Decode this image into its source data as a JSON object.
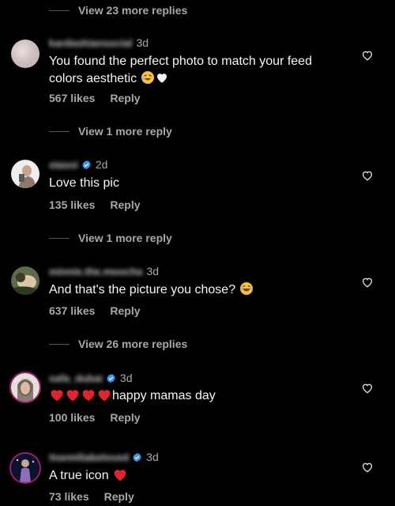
{
  "threads": [
    {
      "view_more": "View 23 more replies"
    },
    {
      "username": "kardashiansocial",
      "verified": false,
      "time": "3d",
      "text": "You found the perfect photo to match your feed colors aesthetic",
      "emoji": [
        "rolling-laughing-emoji",
        "white-heart-emoji"
      ],
      "likes": "567 likes",
      "reply": "Reply",
      "view_more": "View 1 more reply"
    },
    {
      "username": "stassi",
      "verified": true,
      "time": "2d",
      "text": "Love this pic",
      "likes": "135 likes",
      "reply": "Reply",
      "view_more": "View 1 more reply"
    },
    {
      "username": "minnie.the.moocha",
      "verified": false,
      "time": "3d",
      "text": "And that's the picture you chose?",
      "emoji": [
        "laughing-emoji"
      ],
      "likes": "637 likes",
      "reply": "Reply",
      "view_more": "View 26 more replies"
    },
    {
      "username": "safa_dubai",
      "verified": true,
      "time": "3d",
      "text": "happy mamas day",
      "emoji": [
        "red-heart-emoji",
        "red-heart-emoji",
        "red-heart-emoji",
        "red-heart-emoji"
      ],
      "likes": "100 likes",
      "reply": "Reply"
    },
    {
      "username": "itsemiliabeloved",
      "verified": true,
      "time": "3d",
      "text": "A true icon",
      "emoji": [
        "red-heart-emoji"
      ],
      "likes": "73 likes",
      "reply": "Reply"
    }
  ],
  "colors": {
    "background": "#000000",
    "primary_text": "#f5f5f5",
    "secondary_text": "#a8a8a8",
    "verified_blue": "#3897f0",
    "heart_red": "#ed4956"
  }
}
